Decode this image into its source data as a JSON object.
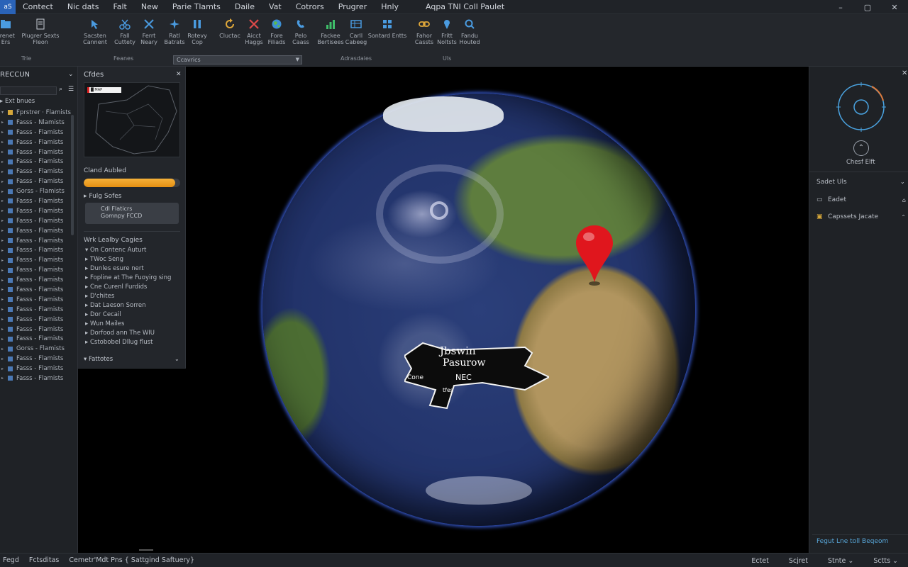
{
  "window": {
    "title": "Aqpa TNI Coll Paulet",
    "controls": [
      "–",
      "▢",
      "✕"
    ]
  },
  "menu": {
    "app_icon": "aS",
    "items": [
      "Contect",
      "Nic dats",
      "Falt",
      "New",
      "Parie Tlamts",
      "Daile",
      "Vat",
      "Cotrors",
      "Prugrer",
      "Hnly"
    ]
  },
  "ribbon": {
    "buttons": [
      {
        "label": "Prenet Ers",
        "icon": "folder-icon",
        "color": "#4a9be0"
      },
      {
        "label": "Plugrer Sexts Fleon",
        "icon": "document-icon",
        "color": "#c9ced6"
      },
      {
        "label": "Sacsten Cannent",
        "icon": "cursor-icon",
        "color": "#4a9be0"
      },
      {
        "label": "Fall Cuttety",
        "icon": "cut-icon",
        "color": "#4a9be0"
      },
      {
        "label": "Ferrt Neary",
        "icon": "tools-icon",
        "color": "#4a9be0"
      },
      {
        "label": "Ratl Batrats",
        "icon": "sparkle-icon",
        "color": "#4a9be0"
      },
      {
        "label": "Rotevy Cop",
        "icon": "pause-icon",
        "color": "#4a9be0"
      },
      {
        "label": "Cluctac",
        "icon": "refresh-icon",
        "color": "#e0a83a"
      },
      {
        "label": "Aicct Haggs",
        "icon": "delete-icon",
        "color": "#e04a4a"
      },
      {
        "label": "Fore Filiads",
        "icon": "globe-icon",
        "color": "#5dbb4a"
      },
      {
        "label": "Pelo Caass",
        "icon": "phone-icon",
        "color": "#4a9be0"
      },
      {
        "label": "Fackee Bertisees",
        "icon": "chart-icon",
        "color": "#3fbf6a"
      },
      {
        "label": "Carll Cabeeg",
        "icon": "table-icon",
        "color": "#4a9be0"
      },
      {
        "label": "Sontard Entts",
        "icon": "grid-icon",
        "color": "#4a9be0"
      },
      {
        "label": "Fahor Cassts",
        "icon": "link-icon",
        "color": "#e0a83a"
      },
      {
        "label": "Fritt Noltsts",
        "icon": "pin-icon",
        "color": "#4a9be0"
      },
      {
        "label": "Fandu Houted",
        "icon": "search-icon",
        "color": "#4a9be0"
      }
    ],
    "groups": [
      "Trie",
      "Feanes",
      "Adrasdaies",
      "Uls"
    ],
    "dropdown": "Ccavrics"
  },
  "left_panel": {
    "title": "RECCUN",
    "root": "Ext bnues",
    "first_item": "Fprstrer · Flamists",
    "items": [
      "Fasss - Nlamists",
      "Fasss - Flamists",
      "Fasss - Flamists",
      "Fasss - Flamists",
      "Fasss - Flamists",
      "Fasss - Flamists",
      "Fasss - Flamists",
      "Gorss - Flamists",
      "Fasss - Flamists",
      "Fasss - Flamists",
      "Fasss - Flamists",
      "Fasss - Flamists",
      "Fasss - Flamists",
      "Fasss - Flamists",
      "Fasss - Flamists",
      "Fasss - Flamists",
      "Fasss - Flamists",
      "Fasss - Flamists",
      "Fasss - Flamists",
      "Fasss - Flamists",
      "Fasss - Flamists",
      "Fasss - Flamists",
      "Fasss - Flamists",
      "Gorss - Flamists",
      "Fasss - Flamists",
      "Fasss - Flamists",
      "Fasss - Flamists"
    ]
  },
  "mid_panel": {
    "title": "Cfdes",
    "mini_map_label": "█ MAP",
    "progress_label": "Cland Aubled",
    "progress": 0.95,
    "section": "Fulg Sofes",
    "box_line1": "Cdl Flaticrs",
    "box_line2": "Gomnpy FCCD",
    "group_title": "Wrk Lealby Cagies",
    "list": [
      "On Contenc Auturt",
      "TWoc Seng",
      "Dunles esure nert",
      "Fopline at The Fuoyirg sing",
      "Cne Curenl Furdids",
      "D'chites",
      "Dat Laeson Sorren",
      "Dor Cecail",
      "Wun Mailes",
      "Dorfood ann The WIU",
      "Cstobobel Dllug flust"
    ],
    "footer": "Fattotes"
  },
  "viewport": {
    "callout_line1": "Jbswin",
    "callout_line2": "Pasurow",
    "callout_line3": "NEC",
    "callout_side": "Cone",
    "callout_small": "tfes"
  },
  "right_panel": {
    "tilt_label": "Chesf Elft",
    "section": "Sadet Uls",
    "rows": [
      {
        "label": "Eadet",
        "icon": "file-icon"
      },
      {
        "label": "Capssets Jacate",
        "icon": "layers-icon"
      }
    ],
    "bottom_link": "Fegut Lne toll Beqeom"
  },
  "status": {
    "left": [
      "Fegd",
      "Fctsditas",
      "Cemetr'Mdt Pns { Sattgind Saftuery}"
    ],
    "right": [
      "Ectet",
      "Scjret",
      "Stnte",
      "Sctts"
    ]
  },
  "colors": {
    "accent": "#2a63b8",
    "progress": "#f0a425",
    "pin": "#e0161d",
    "link": "#58a6d8"
  }
}
